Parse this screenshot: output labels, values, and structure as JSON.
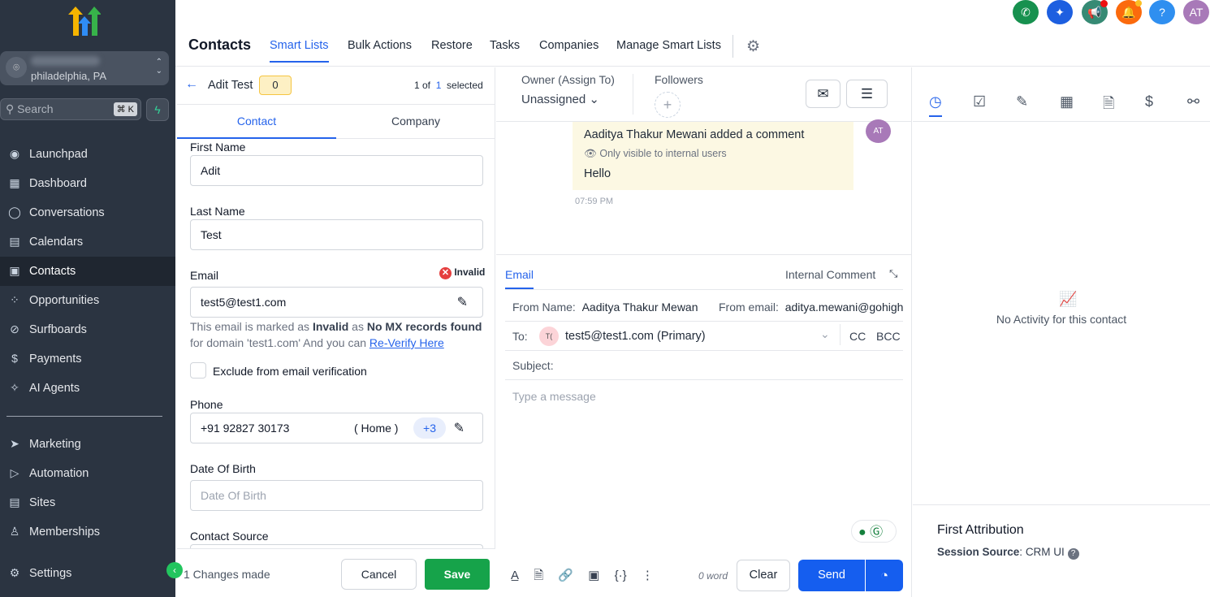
{
  "sidebar": {
    "location": "philadelphia, PA",
    "search_placeholder": "Search",
    "search_shortcut": "⌘ K",
    "items": [
      {
        "label": "Launchpad",
        "icon": "launchpad-icon"
      },
      {
        "label": "Dashboard",
        "icon": "dashboard-icon"
      },
      {
        "label": "Conversations",
        "icon": "chat-icon"
      },
      {
        "label": "Calendars",
        "icon": "calendar-icon"
      },
      {
        "label": "Contacts",
        "icon": "contacts-icon",
        "active": true
      },
      {
        "label": "Opportunities",
        "icon": "opportunities-icon"
      },
      {
        "label": "Surfboards",
        "icon": "surfboard-icon"
      },
      {
        "label": "Payments",
        "icon": "payments-icon"
      },
      {
        "label": "AI Agents",
        "icon": "ai-icon"
      }
    ],
    "items2": [
      {
        "label": "Marketing",
        "icon": "send-icon"
      },
      {
        "label": "Automation",
        "icon": "automation-icon"
      },
      {
        "label": "Sites",
        "icon": "sites-icon"
      },
      {
        "label": "Memberships",
        "icon": "membership-icon"
      }
    ],
    "settings": "Settings"
  },
  "header": {
    "title": "Contacts",
    "tabs": [
      "Smart Lists",
      "Bulk Actions",
      "Restore",
      "Tasks",
      "Companies",
      "Manage Smart Lists"
    ],
    "avatar": "AT"
  },
  "contact": {
    "name": "Adit Test",
    "badge": "0",
    "pager_prefix": "1 of",
    "pager_total": "1",
    "pager_suffix": "selected",
    "tabs": [
      "Contact",
      "Company"
    ],
    "first_name_label": "First Name",
    "first_name": "Adit",
    "last_name_label": "Last Name",
    "last_name": "Test",
    "email_label": "Email",
    "email_status": "Invalid",
    "email": "test5@test1.com",
    "email_note_1": "This email is marked as ",
    "email_note_invalid": "Invalid",
    "email_note_2": " as ",
    "email_note_reason": "No MX records found",
    "email_note_3": " for domain 'test1.com' And you can ",
    "reverify": "Re-Verify Here",
    "exclude_label": "Exclude from email verification",
    "phone_label": "Phone",
    "phone": "+91 92827 30173",
    "phone_type": "( Home )",
    "phone_more": "+3",
    "dob_label": "Date Of Birth",
    "dob_placeholder": "Date Of Birth",
    "source_label": "Contact Source",
    "changes": "1 Changes made",
    "cancel": "Cancel",
    "save": "Save"
  },
  "conversation": {
    "owner_label": "Owner (Assign To)",
    "owner": "Unassigned",
    "followers_label": "Followers",
    "comment_author": "Aaditya Thakur Mewani added a comment",
    "comment_visibility": "Only visible to internal users",
    "comment_text": "Hello",
    "comment_time": "07:59 PM",
    "comment_avatar": "AT",
    "tab_email": "Email",
    "tab_internal": "Internal Comment",
    "from_name_label": "From Name:",
    "from_name": "Aaditya Thakur Mewani",
    "from_email_label": "From email:",
    "from_email": "aditya.mewani@gohighlevel.com",
    "to_label": "To:",
    "to_avatar": "T(",
    "to": "test5@test1.com (Primary)",
    "cc": "CC",
    "bcc": "BCC",
    "subject_label": "Subject:",
    "message_placeholder": "Type a message",
    "word_count": "0 word",
    "clear": "Clear",
    "send": "Send"
  },
  "activity": {
    "empty": "No Activity for this contact",
    "attribution_title": "First Attribution",
    "session_label": "Session Source",
    "session_value": "CRM UI"
  },
  "colors": {
    "sidebar": "#2b3441",
    "accent": "#2563eb",
    "save": "#16a34a"
  }
}
